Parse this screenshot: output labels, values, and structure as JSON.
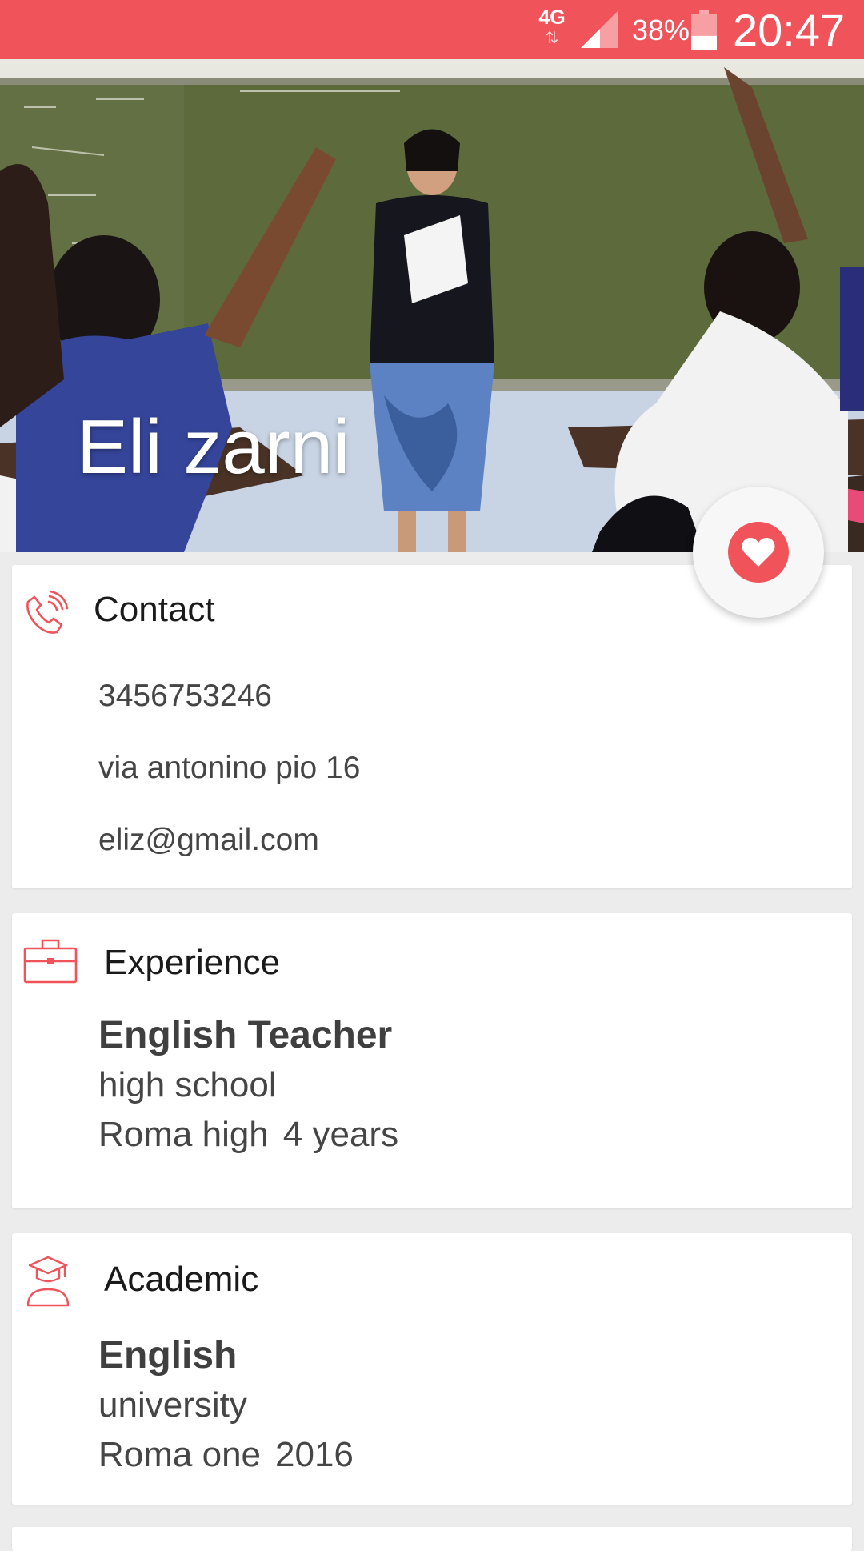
{
  "status_bar": {
    "network": "4G",
    "network_activity": "⇅",
    "battery_percent": "38%",
    "battery_level": 0.38,
    "time": "20:47"
  },
  "profile": {
    "name": "Eli zarni",
    "favorite_icon": "heart-icon"
  },
  "contact": {
    "title": "Contact",
    "icon": "phone-icon",
    "phone": "3456753246",
    "address": "via antonino pio 16",
    "email": "eliz@gmail.com"
  },
  "experience": {
    "title": "Experience",
    "icon": "briefcase-icon",
    "role": "English Teacher",
    "level": "high school",
    "institution": "Roma high",
    "duration": "4 years"
  },
  "academic": {
    "title": "Academic",
    "icon": "graduate-icon",
    "subject": "English",
    "level": "university",
    "institution": "Roma one",
    "year": "2016"
  },
  "colors": {
    "accent": "#f0535a",
    "background": "#ececec",
    "card": "#ffffff"
  }
}
